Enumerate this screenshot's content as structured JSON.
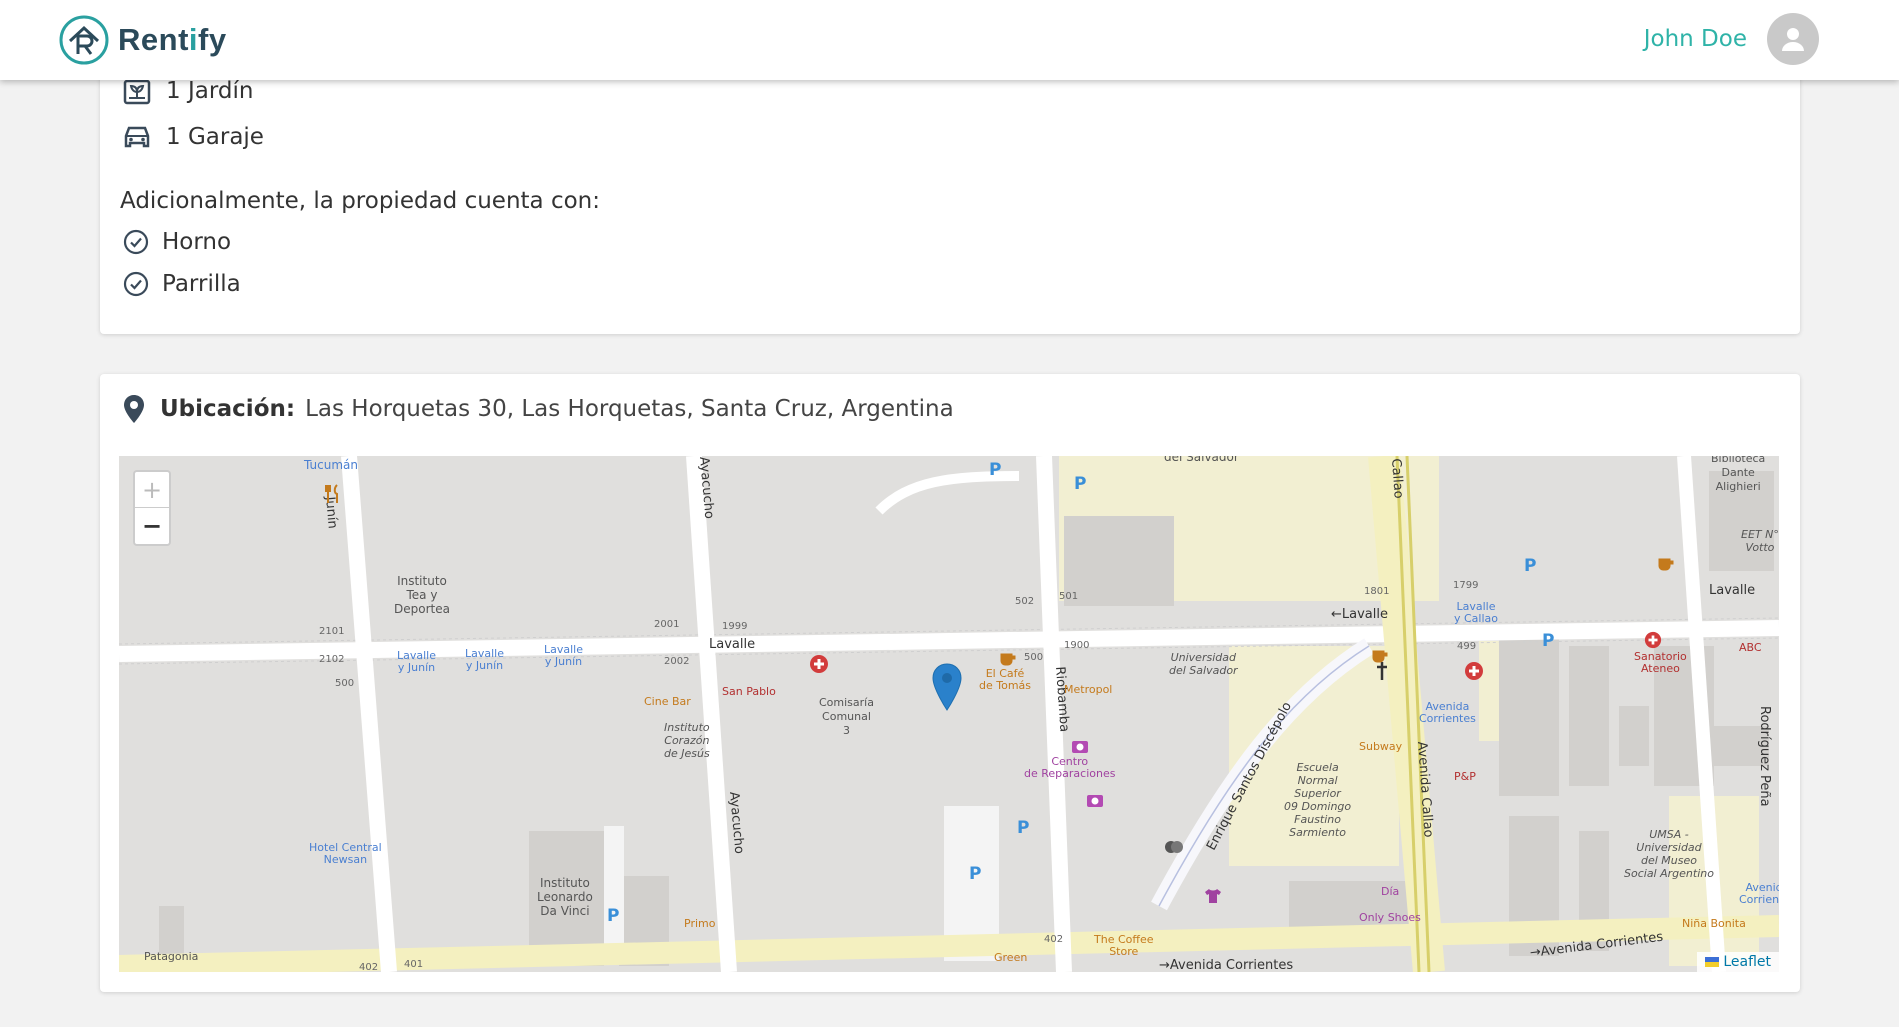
{
  "header": {
    "brand_prefix": "Rent",
    "brand_accent": "i",
    "brand_suffix": "fy",
    "user_name": "John Doe"
  },
  "features": [
    {
      "icon": "garden-icon",
      "label": "1 Jardín"
    },
    {
      "icon": "car-icon",
      "label": "1 Garaje"
    }
  ],
  "extras": {
    "intro": "Adicionalmente, la propiedad cuenta con:",
    "items": [
      "Horno",
      "Parrilla"
    ]
  },
  "location": {
    "label": "Ubicación:",
    "value": "Las Horquetas 30, Las Horquetas, Santa Cruz, Argentina"
  },
  "map": {
    "zoom_in": "+",
    "zoom_out": "−",
    "attribution": "Leaflet",
    "streets": {
      "tucuman": "Tucumán",
      "junin": "Junín",
      "ayacucho_top": "Ayacucho",
      "ayacucho_bottom": "Ayacucho",
      "lavalle_left": "Lavalle",
      "lavalle_mid": "←Lavalle",
      "lavalle_right": "Lavalle",
      "riobamba": "Riobamba",
      "callao_top": "Callao",
      "avenida_callao": "Avenida Callao",
      "discepolo": "Enrique Santos Discépolo",
      "corrientes_mid": "→Avenida Corrientes",
      "corrientes_right": "→Avenida Corrientes",
      "rodriguez_pena": "Rodríguez Peña"
    },
    "pois": {
      "instituto_tea": "Instituto\nTea y\nDeportea",
      "lavalle_junin_1": "Lavalle\ny Junín",
      "lavalle_junin_2": "Lavalle\ny Junín",
      "lavalle_junin_3": "Lavalle\ny Junín",
      "cine_bar": "Cine Bar",
      "san_pablo": "San Pablo",
      "comisaria": "Comisaría\nComunal\n3",
      "corazon_jesus": "Instituto\nCorazón\nde Jesús",
      "el_cafe_tomas": "El Café\nde Tomás",
      "metropol": "Metropol",
      "univ_salvador": "Universidad\ndel Salvador",
      "univ_salvador_top": "del Salvador",
      "centro_reparaciones": "Centro\nde Reparaciones",
      "escuela_normal": "Escuela\nNormal\nSuperior\n09 Domingo\nFaustino\nSarmiento",
      "subway": "Subway",
      "pyp": "P&P",
      "avenida_corrientes_bus": "Avenida\nCorrientes",
      "lavalle_callao": "Lavalle\ny Callao",
      "sanatorio_ateneo": "Sanatorio\nAteneo",
      "abc": "ABC",
      "umsa": "UMSA -\nUniversidad\ndel Museo\nSocial Argentino",
      "only_shoes": "Only Shoes",
      "dia": "Día",
      "nina_bonita": "Niña Bonita",
      "the_coffee_store": "The Coffee\nStore",
      "hotel_newsan": "Hotel Central\nNewsan",
      "instituto_davinci": "Instituto\nLeonardo\nDa Vinci",
      "primo": "Primo",
      "patagonia": "Patagonia",
      "green": "Green",
      "biblioteca_dante": "Biblioteca\nDante\nAlighieri",
      "eet_votto": "EET N°\nVotto",
      "avenida_corrientes_r": "Avenida\nCorrientes"
    },
    "numbers": [
      "2101",
      "2102",
      "500",
      "2001",
      "1999",
      "2002",
      "502",
      "501",
      "500",
      "1900",
      "1801",
      "1799",
      "499",
      "402",
      "401",
      "402"
    ]
  }
}
